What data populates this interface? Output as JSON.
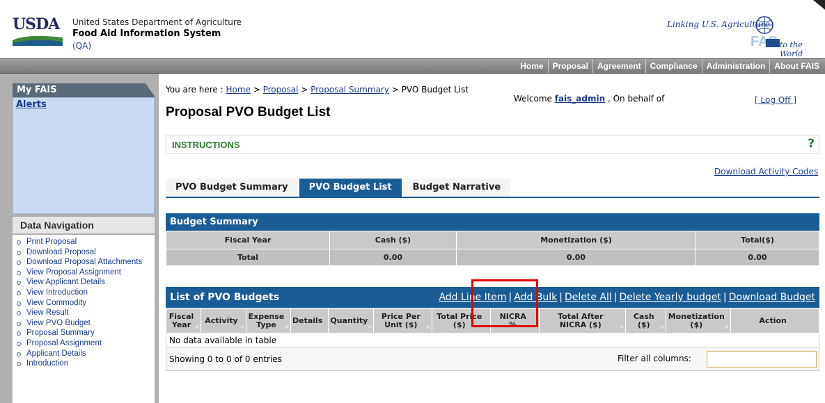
{
  "header": {
    "logo_text": "USDA",
    "agency_name": "United States Department of Agriculture",
    "system_name": "Food Aid Information System",
    "environment": "(QA)",
    "slogan": "Linking U.S. Agriculture",
    "fas_logo_text": "FAS",
    "fas_tag": "to the World"
  },
  "topnav": {
    "items": [
      "Home",
      "Proposal",
      "Agreement",
      "Compliance",
      "Administration",
      "About FAIS"
    ]
  },
  "sidebar": {
    "myfais_title": "My FAIS",
    "alerts_label": "Alerts",
    "datanav_title": "Data Navigation",
    "datanav_items": [
      "Print Proposal",
      "Download Proposal",
      "Download Proposal Attachments",
      "View Proposal Assignment",
      "View Applicant Details",
      "View Introduction",
      "View Commodity",
      "View Result",
      "View PVO Budget",
      "Proposal Summary",
      "Proposal Assignment",
      "Applicant Details",
      "Introduction"
    ]
  },
  "breadcrumb": {
    "prefix": "You are here : ",
    "sep": " > ",
    "home": "Home",
    "proposal": "Proposal",
    "proposal_summary": "Proposal Summary",
    "current": "PVO Budget List"
  },
  "welcome": {
    "prefix": "Welcome ",
    "user": "fais_admin",
    "suffix": " , On behalf of",
    "logoff": "[ Log Off ]"
  },
  "page": {
    "title": "Proposal PVO Budget List",
    "instructions": "INSTRUCTIONS",
    "help": "?",
    "download_codes": "Download Activity Codes"
  },
  "tabs": [
    {
      "label": "PVO Budget Summary",
      "active": false
    },
    {
      "label": "PVO Budget List",
      "active": true
    },
    {
      "label": "Budget Narrative",
      "active": false
    }
  ],
  "budget_summary": {
    "title": "Budget Summary",
    "columns": [
      "Fiscal Year",
      "Cash ($)",
      "Monetization ($)",
      "Total($)"
    ],
    "total_row": [
      "Total",
      "0.00",
      "0.00",
      "0.00"
    ]
  },
  "pvo_list": {
    "title": "List of PVO Budgets",
    "actions": [
      "Add Line Item",
      "Add Bulk",
      "Delete All",
      "Delete Yearly budget",
      "Download Budget"
    ],
    "columns": [
      [
        "Fiscal",
        "Year"
      ],
      [
        "Activity"
      ],
      [
        "Expense",
        "Type"
      ],
      [
        "Details"
      ],
      [
        "Quantity"
      ],
      [
        "Price Per",
        "Unit ($)"
      ],
      [
        "Total Price",
        "($)"
      ],
      [
        "NICRA",
        "%"
      ],
      [
        "Total After",
        "NICRA ($)"
      ],
      [
        "Cash",
        "($)"
      ],
      [
        "Monetization",
        "($)"
      ],
      [
        "Action"
      ]
    ],
    "empty_message": "No data available in table",
    "entries_info": "Showing 0 to 0 of 0 entries",
    "filter_label": "Filter all columns:",
    "filter_value": ""
  }
}
